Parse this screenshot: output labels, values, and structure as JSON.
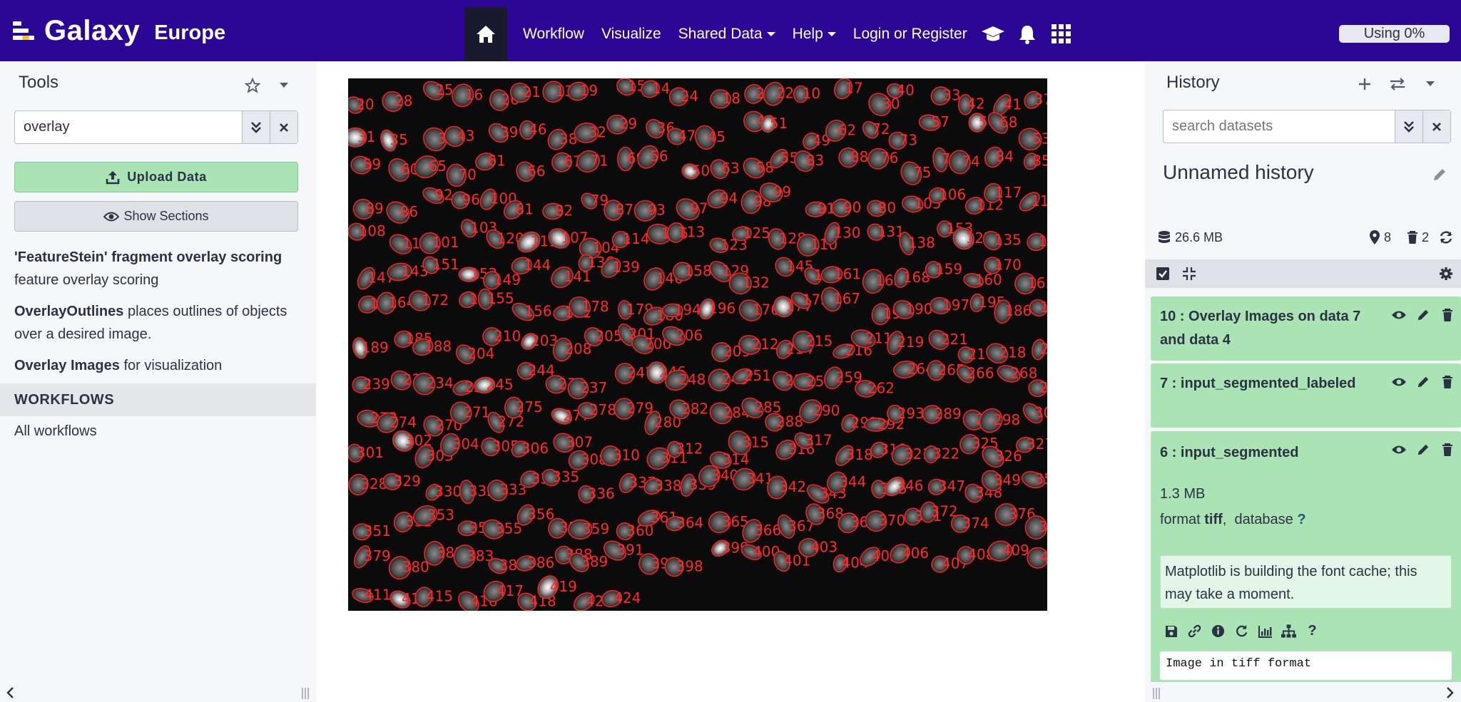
{
  "masthead": {
    "brand": "Galaxy",
    "brand_sub": "Europe",
    "nav": {
      "workflow": "Workflow",
      "visualize": "Visualize",
      "shared_data": "Shared Data",
      "help": "Help",
      "login": "Login or Register"
    },
    "quota": "Using 0%"
  },
  "tools_panel": {
    "title": "Tools",
    "search_value": "overlay",
    "upload_label": "Upload Data",
    "sections_label": "Show Sections",
    "results": [
      {
        "name": "'FeatureStein' fragment overlay scoring",
        "desc": "feature overlay scoring"
      },
      {
        "name": "OverlayOutlines",
        "desc": "places outlines of objects over a desired image."
      },
      {
        "name": "Overlay Images",
        "desc": "for visualization"
      }
    ],
    "workflows_header": "WORKFLOWS",
    "all_workflows": "All workflows"
  },
  "history_panel": {
    "title": "History",
    "search_placeholder": "search datasets",
    "name": "Unnamed history",
    "size": "26.6 MB",
    "shown_count": "8",
    "deleted_count": "2",
    "datasets": [
      {
        "title": "10 : Overlay Images on data 7 and data 4"
      },
      {
        "title": "7 : input_segmented_labeled"
      },
      {
        "title": "6 : input_segmented",
        "size": "1.3 MB",
        "format_label": "format",
        "format": "tiff",
        "database_label": "database",
        "database": "?",
        "info": "Matplotlib is building the font cache; this may take a moment.",
        "peek": "Image in tiff format"
      }
    ]
  },
  "visualization": {
    "outline_color": "#ff2020",
    "label_color": "#ff2a2a",
    "labels": [
      "20",
      "28",
      "25",
      "16",
      "26",
      "21",
      "13",
      "19",
      "15",
      "14",
      "24",
      "18",
      "23",
      "22",
      "10",
      "17",
      "30",
      "40",
      "33",
      "42",
      "41",
      "37",
      "31",
      "35",
      "34",
      "43",
      "39",
      "46",
      "38",
      "32",
      "29",
      "36",
      "47",
      "45",
      "48",
      "51",
      "49",
      "62",
      "72",
      "73",
      "57",
      "54",
      "68",
      "53",
      "59",
      "60",
      "65",
      "70",
      "61",
      "66",
      "67",
      "71",
      "69",
      "56",
      "50",
      "63",
      "58",
      "55",
      "83",
      "88",
      "76",
      "75",
      "78",
      "74",
      "84",
      "85",
      "89",
      "86",
      "92",
      "96",
      "100",
      "81",
      "82",
      "79",
      "87",
      "93",
      "97",
      "94",
      "98",
      "99",
      "91",
      "90",
      "80",
      "105",
      "106",
      "112",
      "117",
      "118",
      "108",
      "111",
      "101",
      "103",
      "120",
      "119",
      "107",
      "104",
      "114",
      "116",
      "113",
      "123",
      "125",
      "128",
      "110",
      "130",
      "131",
      "138",
      "153",
      "127",
      "135",
      "140",
      "147",
      "143",
      "151",
      "152",
      "149",
      "144",
      "141",
      "136",
      "139",
      "146",
      "158",
      "129",
      "132",
      "145",
      "142",
      "161",
      "162",
      "168",
      "159",
      "160",
      "170",
      "165",
      "166",
      "164",
      "172",
      "171",
      "155",
      "156",
      "181",
      "178",
      "179",
      "180",
      "194",
      "196",
      "176",
      "177",
      "175",
      "167",
      "198",
      "190",
      "197",
      "195",
      "186",
      "191",
      "189",
      "185",
      "188",
      "204",
      "210",
      "203",
      "208",
      "205",
      "201",
      "200",
      "206",
      "209",
      "212",
      "214",
      "215",
      "216",
      "211",
      "219",
      "221",
      "217",
      "218",
      "225",
      "239",
      "228",
      "234",
      "236",
      "245",
      "244",
      "235",
      "237",
      "247",
      "246",
      "248",
      "249",
      "251",
      "255",
      "257",
      "259",
      "262",
      "264",
      "265",
      "266",
      "268",
      "269",
      "273",
      "274",
      "270",
      "271",
      "272",
      "275",
      "277",
      "278",
      "279",
      "280",
      "282",
      "284",
      "285",
      "288",
      "290",
      "291",
      "292",
      "293",
      "289",
      "294",
      "298",
      "300",
      "301",
      "302",
      "303",
      "304",
      "305",
      "306",
      "307",
      "308",
      "310",
      "311",
      "312",
      "314",
      "315",
      "316",
      "317",
      "318",
      "319",
      "321",
      "322",
      "325",
      "326",
      "327",
      "328",
      "329",
      "330",
      "332",
      "333",
      "334",
      "335",
      "336",
      "337",
      "338",
      "339",
      "340",
      "341",
      "342",
      "343",
      "344",
      "345",
      "346",
      "347",
      "348",
      "349",
      "350",
      "351",
      "352",
      "353",
      "354",
      "355",
      "356",
      "358",
      "359",
      "360",
      "361",
      "364",
      "365",
      "366",
      "367",
      "368",
      "369",
      "370",
      "371",
      "372",
      "374",
      "376",
      "378",
      "379",
      "380",
      "381",
      "383",
      "385",
      "386",
      "388",
      "389",
      "391",
      "394",
      "398",
      "399",
      "400",
      "401",
      "403",
      "404",
      "405",
      "406",
      "407",
      "408",
      "409",
      "410",
      "411",
      "414",
      "415",
      "416",
      "417",
      "418",
      "419",
      "421",
      "424"
    ]
  }
}
